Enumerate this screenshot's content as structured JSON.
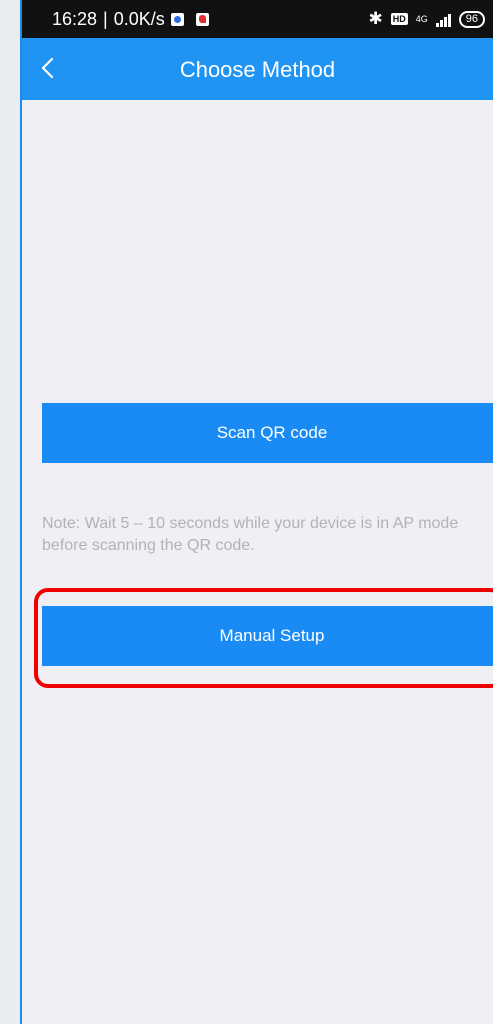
{
  "status_bar": {
    "time": "16:28",
    "separator": "|",
    "speed": "0.0K/s",
    "network": "4G",
    "battery": "96"
  },
  "header": {
    "title": "Choose Method",
    "back_icon": "chevron-left-icon"
  },
  "main": {
    "scan_button_label": "Scan QR code",
    "note": "Note: Wait 5 – 10 seconds while your device is in AP mode before scanning the QR code.",
    "manual_button_label": "Manual Setup"
  },
  "colors": {
    "accent": "#2094f3",
    "button": "#1a8af5",
    "highlight": "#f00000",
    "background": "#efeff4"
  }
}
